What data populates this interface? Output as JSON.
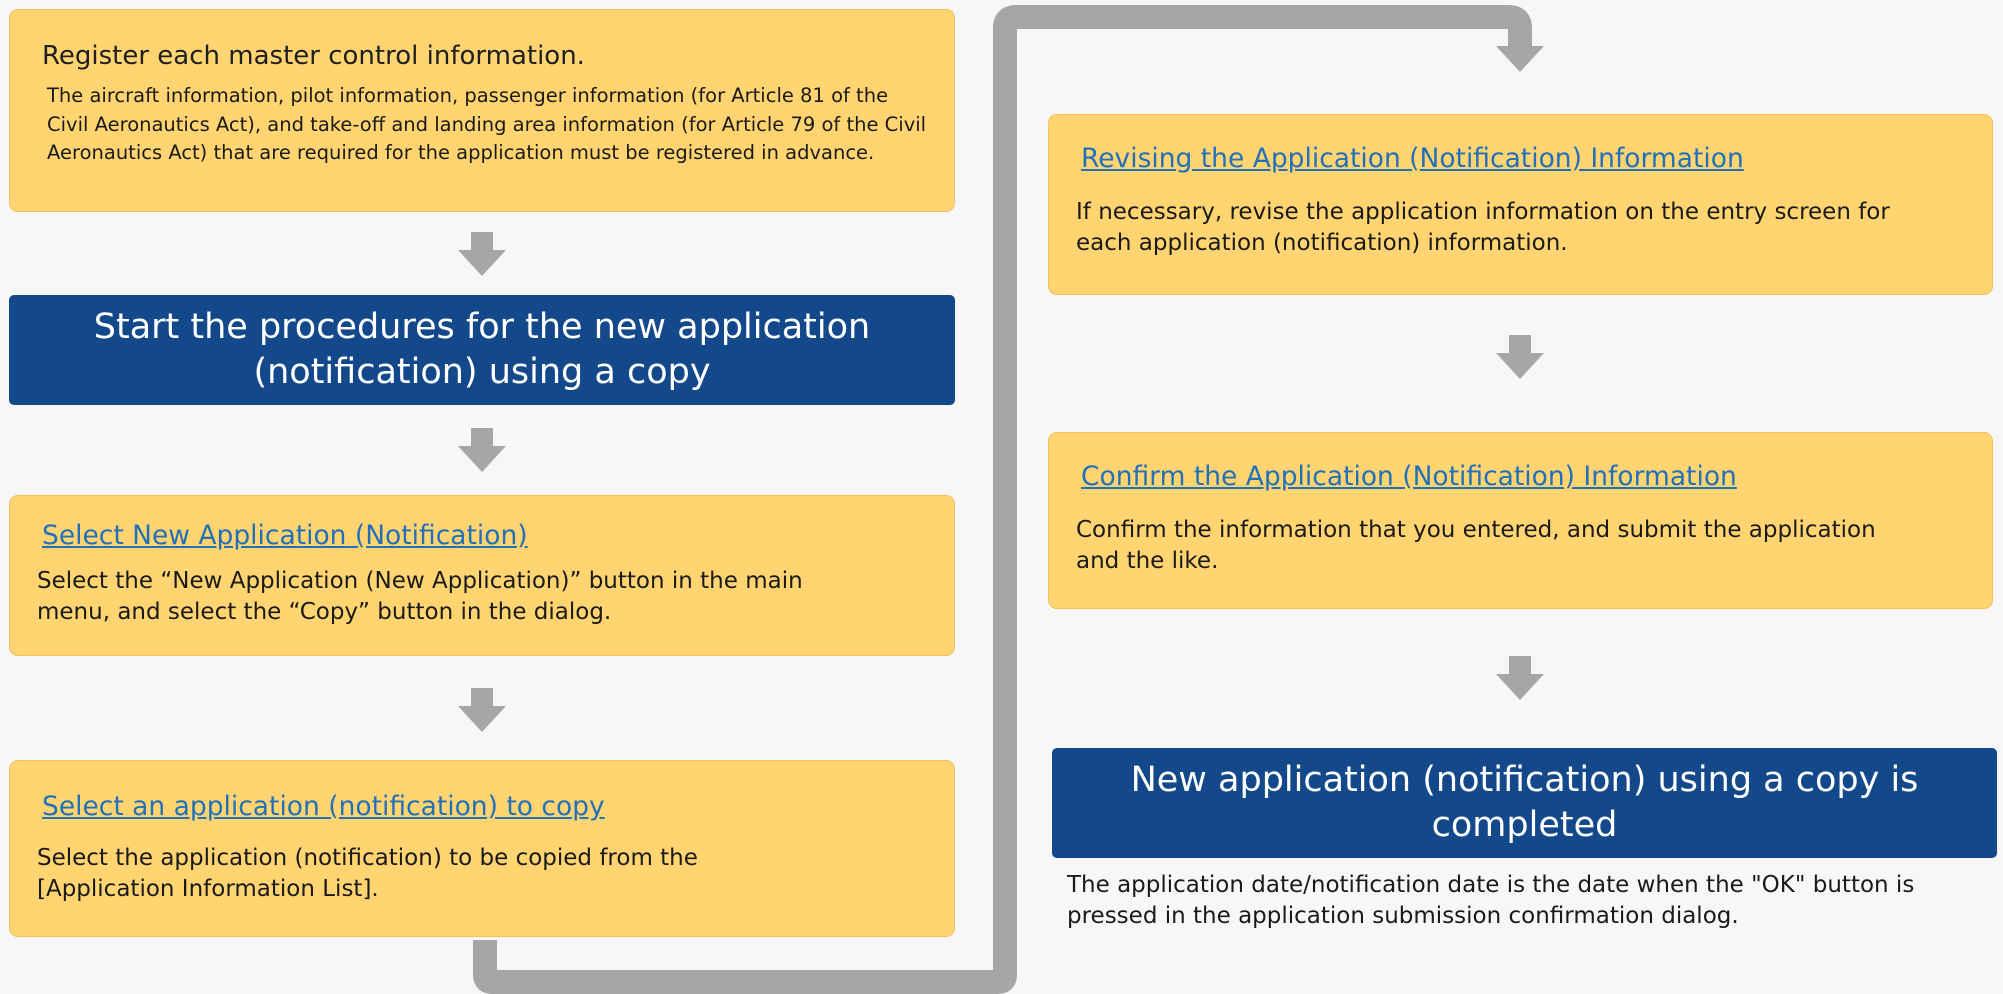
{
  "left_column": {
    "register": {
      "title": "Register each master control information.",
      "body": "The aircraft information, pilot information, passenger information (for Article 81 of the Civil Aeronautics Act), and take-off and landing area information (for Article 79 of the Civil Aeronautics Act) that are required for the application must be registered in advance."
    },
    "start": {
      "title": "Start the procedures for the new application (notification) using a copy"
    },
    "select_new": {
      "link": "Select New Application (Notification)",
      "body": "Select the “New Application (New Application)” button in the main menu, and select the “Copy” button in the dialog."
    },
    "select_copy": {
      "link": "Select an application (notification) to copy",
      "body": "Select the application (notification) to be copied from the [Application Information List]."
    }
  },
  "right_column": {
    "revise": {
      "link": "Revising the Application (Notification) Information",
      "body": "If necessary, revise the application information on the entry screen for each application (notification) information."
    },
    "confirm": {
      "link": "Confirm the Application (Notification) Information",
      "body": "Confirm the information that you entered, and submit the application and the like."
    },
    "completed": {
      "title": "New application (notification) using a copy is completed"
    },
    "footnote": "The application date/notification date is the date when the \"OK\" button is pressed in the application submission confirmation dialog."
  },
  "colors": {
    "yellow_box": "#ffd471",
    "blue_box": "#13498a",
    "link": "#2271b8",
    "arrow": "#a6a6a6",
    "background": "#f7f7f7"
  }
}
